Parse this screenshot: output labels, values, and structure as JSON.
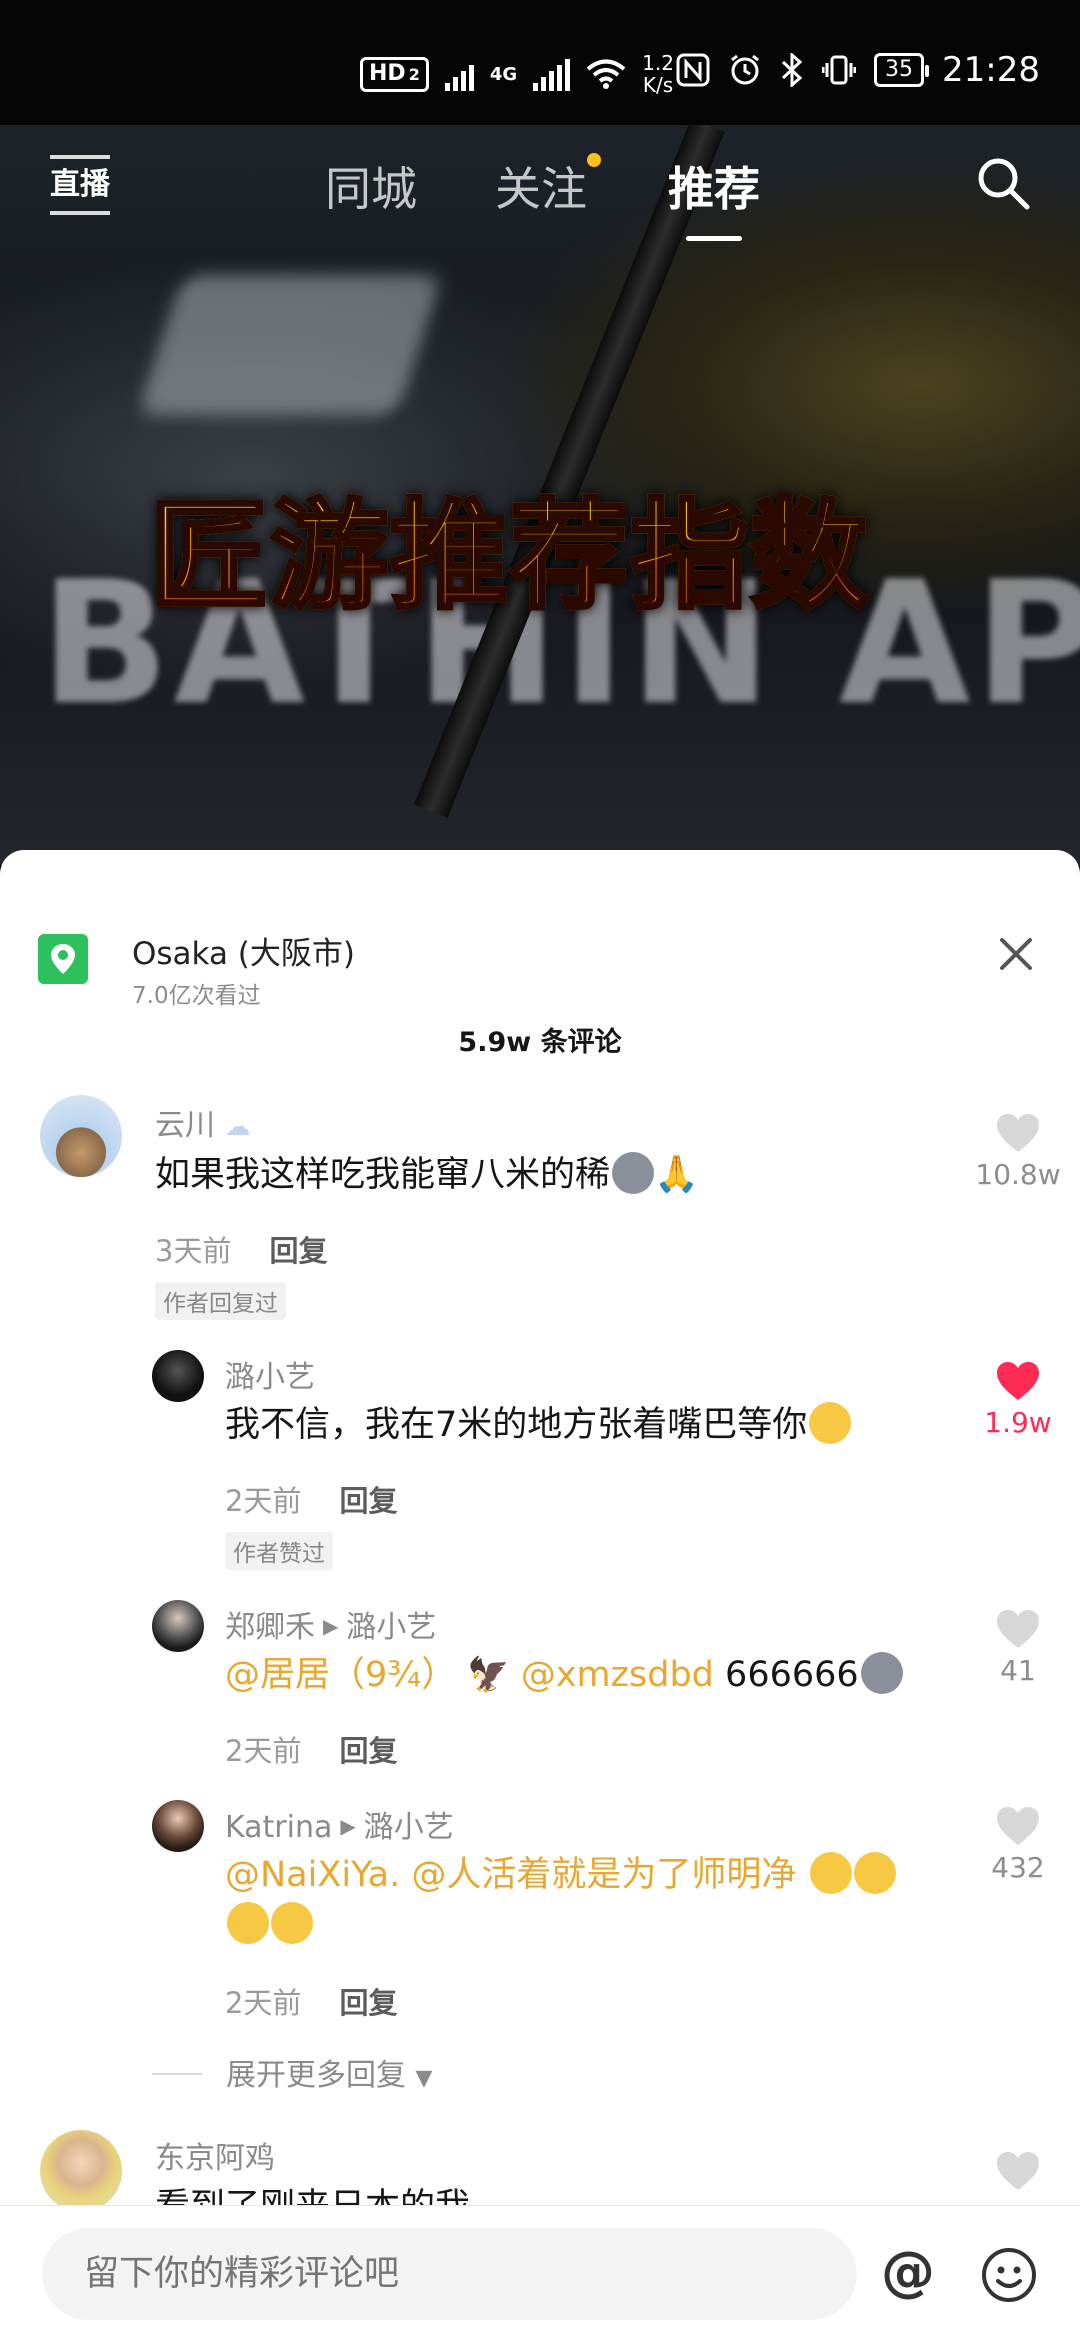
{
  "status_bar": {
    "hd_label": "HD",
    "sim_slot": "2",
    "network_type": "4G",
    "net_speed_value": "1.2",
    "net_speed_unit": "K/s",
    "battery_level": "35",
    "time": "21:28"
  },
  "top_nav": {
    "live_label": "直播",
    "tabs": [
      {
        "label": "同城",
        "active": false
      },
      {
        "label": "关注",
        "active": false,
        "has_dot": true
      },
      {
        "label": "推荐",
        "active": true
      }
    ]
  },
  "video": {
    "overlay_title": "匠游推荐指数",
    "background_text": "BATHIN AP"
  },
  "location": {
    "name": "Osaka (大阪市)",
    "views": "7.0亿次看过"
  },
  "comments_header": {
    "count_label": "5.9w 条评论"
  },
  "comments": [
    {
      "user": "云川",
      "text": "如果我这样吃我能窜八米的稀",
      "time": "3天前",
      "reply_label": "回复",
      "tag": "作者回复过",
      "likes": "10.8w",
      "liked": false
    },
    {
      "user": "潞小艺",
      "text": "我不信，我在7米的地方张着嘴巴等你",
      "time": "2天前",
      "reply_label": "回复",
      "tag": "作者赞过",
      "likes": "1.9w",
      "liked": true
    },
    {
      "user": "郑卿禾",
      "reply_to": "潞小艺",
      "mention_1": "@居居（9¾）",
      "mention_2": "@xmzsdbd",
      "text": "666666",
      "time": "2天前",
      "reply_label": "回复",
      "likes": "41",
      "liked": false
    },
    {
      "user": "Katrina",
      "reply_to": "潞小艺",
      "mention_1": "@NaiXiYa.",
      "mention_2": "@人活着就是为了师明净",
      "time": "2天前",
      "reply_label": "回复",
      "likes": "432",
      "liked": false
    },
    {
      "user": "东京阿鸡",
      "text": "看到了刚来日本的我",
      "liked": false
    }
  ],
  "expand_replies_label": "展开更多回复",
  "input_bar": {
    "placeholder": "留下你的精彩评论吧",
    "at_symbol": "@"
  },
  "colors": {
    "like_active": "#fe2c55",
    "mention": "#e8a72f",
    "location_icon": "#2bc15c",
    "unread_dot": "#ffc01f"
  }
}
